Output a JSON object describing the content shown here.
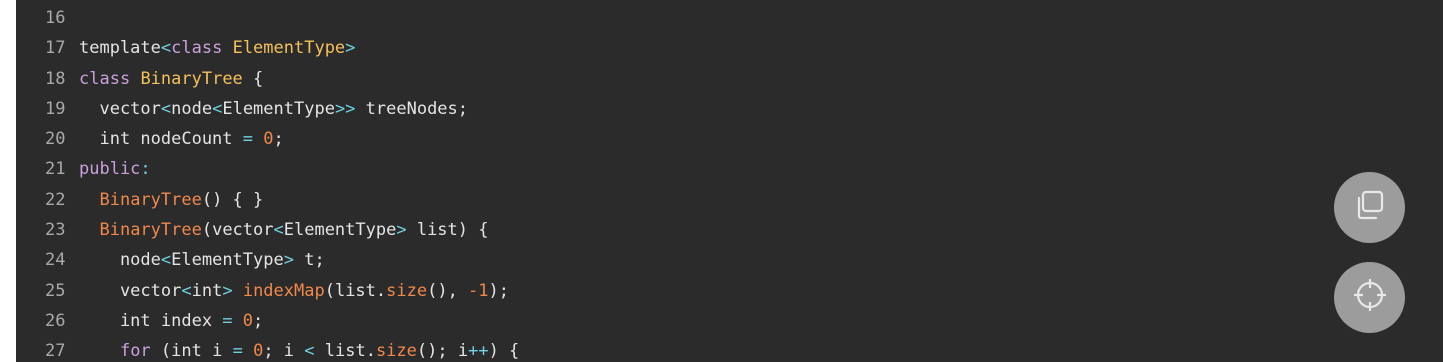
{
  "code": {
    "lines": [
      {
        "n": "16",
        "tokens": []
      },
      {
        "n": "17",
        "tokens": [
          {
            "t": "id",
            "v": "template"
          },
          {
            "t": "punc",
            "v": "<"
          },
          {
            "t": "kw",
            "v": "class"
          },
          {
            "t": "id",
            "v": " "
          },
          {
            "t": "ty",
            "v": "ElementType"
          },
          {
            "t": "punc",
            "v": ">"
          }
        ]
      },
      {
        "n": "18",
        "tokens": [
          {
            "t": "kw",
            "v": "class"
          },
          {
            "t": "id",
            "v": " "
          },
          {
            "t": "ty",
            "v": "BinaryTree"
          },
          {
            "t": "id",
            "v": " {"
          }
        ]
      },
      {
        "n": "19",
        "tokens": [
          {
            "t": "id",
            "v": "  vector"
          },
          {
            "t": "punc",
            "v": "<"
          },
          {
            "t": "id",
            "v": "node"
          },
          {
            "t": "punc",
            "v": "<"
          },
          {
            "t": "id",
            "v": "ElementType"
          },
          {
            "t": "punc",
            "v": ">>"
          },
          {
            "t": "id",
            "v": " treeNodes;"
          }
        ]
      },
      {
        "n": "20",
        "tokens": [
          {
            "t": "id",
            "v": "  int nodeCount "
          },
          {
            "t": "punc",
            "v": "="
          },
          {
            "t": "id",
            "v": " "
          },
          {
            "t": "num",
            "v": "0"
          },
          {
            "t": "id",
            "v": ";"
          }
        ]
      },
      {
        "n": "21",
        "tokens": [
          {
            "t": "kw",
            "v": "public"
          },
          {
            "t": "punc",
            "v": ":"
          }
        ]
      },
      {
        "n": "22",
        "tokens": [
          {
            "t": "id",
            "v": "  "
          },
          {
            "t": "fn",
            "v": "BinaryTree"
          },
          {
            "t": "id",
            "v": "() { }"
          }
        ]
      },
      {
        "n": "23",
        "tokens": [
          {
            "t": "id",
            "v": "  "
          },
          {
            "t": "fn",
            "v": "BinaryTree"
          },
          {
            "t": "id",
            "v": "(vector"
          },
          {
            "t": "punc",
            "v": "<"
          },
          {
            "t": "id",
            "v": "ElementType"
          },
          {
            "t": "punc",
            "v": ">"
          },
          {
            "t": "id",
            "v": " list) {"
          }
        ]
      },
      {
        "n": "24",
        "tokens": [
          {
            "t": "id",
            "v": "    node"
          },
          {
            "t": "punc",
            "v": "<"
          },
          {
            "t": "id",
            "v": "ElementType"
          },
          {
            "t": "punc",
            "v": ">"
          },
          {
            "t": "id",
            "v": " t;"
          }
        ]
      },
      {
        "n": "25",
        "tokens": [
          {
            "t": "id",
            "v": "    vector"
          },
          {
            "t": "punc",
            "v": "<"
          },
          {
            "t": "id",
            "v": "int"
          },
          {
            "t": "punc",
            "v": ">"
          },
          {
            "t": "id",
            "v": " "
          },
          {
            "t": "fn",
            "v": "indexMap"
          },
          {
            "t": "id",
            "v": "(list."
          },
          {
            "t": "fn",
            "v": "size"
          },
          {
            "t": "id",
            "v": "(), "
          },
          {
            "t": "num",
            "v": "-1"
          },
          {
            "t": "id",
            "v": ");"
          }
        ]
      },
      {
        "n": "26",
        "tokens": [
          {
            "t": "id",
            "v": "    int index "
          },
          {
            "t": "punc",
            "v": "="
          },
          {
            "t": "id",
            "v": " "
          },
          {
            "t": "num",
            "v": "0"
          },
          {
            "t": "id",
            "v": ";"
          }
        ]
      },
      {
        "n": "27",
        "tokens": [
          {
            "t": "id",
            "v": "    "
          },
          {
            "t": "kw",
            "v": "for"
          },
          {
            "t": "id",
            "v": " (int i "
          },
          {
            "t": "punc",
            "v": "="
          },
          {
            "t": "id",
            "v": " "
          },
          {
            "t": "num",
            "v": "0"
          },
          {
            "t": "id",
            "v": "; i "
          },
          {
            "t": "punc",
            "v": "<"
          },
          {
            "t": "id",
            "v": " list."
          },
          {
            "t": "fn",
            "v": "size"
          },
          {
            "t": "id",
            "v": "(); i"
          },
          {
            "t": "punc",
            "v": "++"
          },
          {
            "t": "id",
            "v": ") {"
          }
        ]
      }
    ]
  },
  "buttons": {
    "copy_icon": "copy-icon",
    "locate_icon": "crosshair-icon"
  },
  "colors": {
    "background": "#2b2b2b",
    "keyword": "#c9a0dc",
    "type": "#f4c05a",
    "function": "#f0884b",
    "number": "#f0884b",
    "operator": "#6fd3e0",
    "text": "#e4e4e4",
    "line_number": "#a9a9a9",
    "fab": "#9c9c9c"
  }
}
